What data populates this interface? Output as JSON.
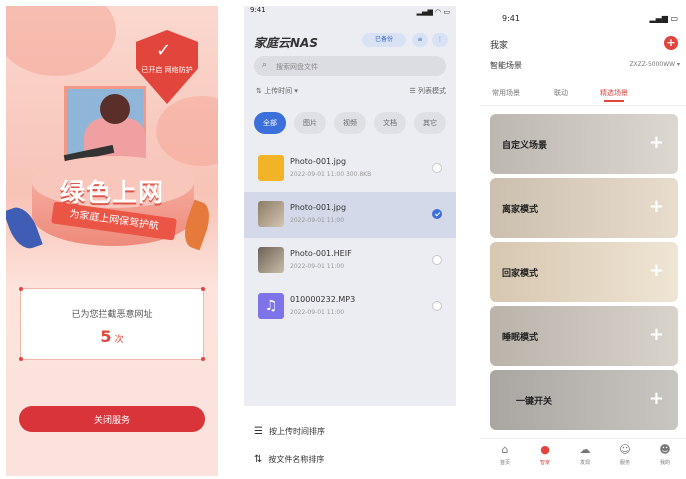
{
  "p1": {
    "shield_badge": "已开启 网络防护",
    "title": "绿色上网",
    "subtitle": "为家庭上网保驾护航",
    "intercept_label": "已为您拦截恶意网址",
    "intercept_count": "5",
    "intercept_unit": "次",
    "close_button": "关闭服务",
    "colors": {
      "accent": "#d8343a",
      "pink": "#f7c3b6"
    }
  },
  "p2": {
    "status_time": "9:41",
    "status_icons": "▂▄▆ ◠ ▭",
    "app_title": "家庭云NAS",
    "pill_label": "已备份",
    "pill_icon": "≡",
    "search_placeholder": "搜索网盘文件",
    "sort_label": "上传时间",
    "view_label": "列表模式",
    "tabs": [
      "全部",
      "图片",
      "视频",
      "文档",
      "其它"
    ],
    "files": [
      {
        "name": "Photo-001.jpg",
        "meta": "2022-09-01 11:00  300.8KB",
        "icon": "folder-icon",
        "selected": false
      },
      {
        "name": "Photo-001.jpg",
        "meta": "2022-09-01 11:00",
        "icon": "image-icon",
        "selected": true
      },
      {
        "name": "Photo-001.HEIF",
        "meta": "2022-09-01 11:00",
        "icon": "image-icon",
        "selected": false
      },
      {
        "name": "010000232.MP3",
        "meta": "2022-09-01 11:00",
        "icon": "music-icon",
        "selected": false
      }
    ],
    "sheet": [
      {
        "icon": "list-icon",
        "label": "按上传时间排序"
      },
      {
        "icon": "sort-icon",
        "label": "按文件名称排序"
      }
    ]
  },
  "p3": {
    "status_time": "9:41",
    "status_icons": "▂▄▆ ▭",
    "home_label": "我家",
    "subtitle": "智能场景",
    "subtitle_right": "ZXZZ-5000WW ▾",
    "tabs": [
      "常用场景",
      "联动",
      "精选场景"
    ],
    "active_tab": 2,
    "scenes": [
      {
        "label": "自定义场景",
        "tone": "#c9c4bf"
      },
      {
        "label": "离家模式",
        "tone": "#d9cfc1"
      },
      {
        "label": "回家模式",
        "tone": "#e2d6c4"
      },
      {
        "label": "睡眠模式",
        "tone": "#c7c3bc"
      },
      {
        "label": "一键开关",
        "tone": "#b9b6b2"
      }
    ],
    "tabbar": [
      {
        "icon": "home-icon",
        "label": "首页"
      },
      {
        "icon": "location-icon",
        "label": "智家"
      },
      {
        "icon": "cloud-icon",
        "label": "发现"
      },
      {
        "icon": "smile-icon",
        "label": "服务"
      },
      {
        "icon": "user-icon",
        "label": "我的"
      }
    ]
  }
}
